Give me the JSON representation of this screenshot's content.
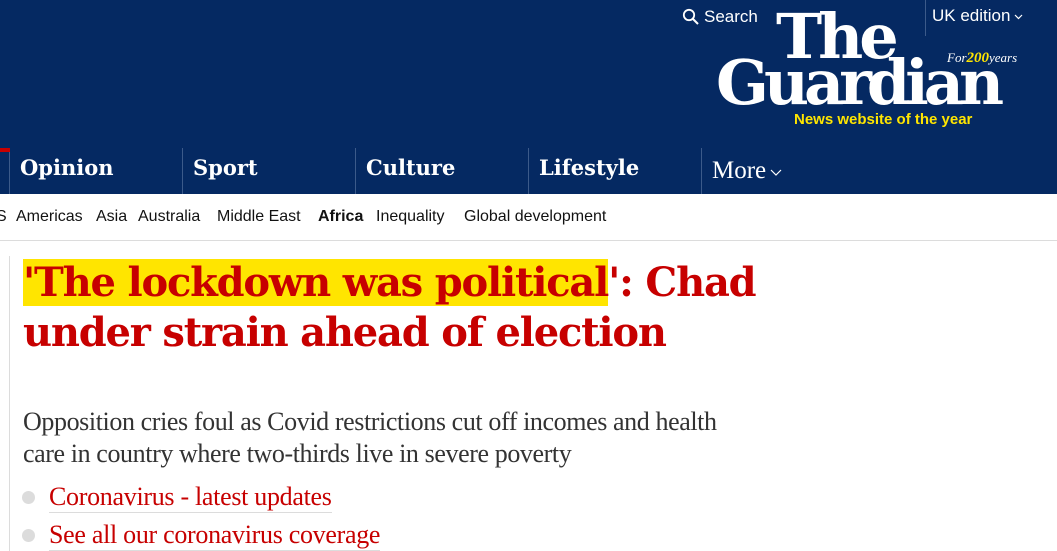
{
  "header": {
    "search_label": "Search",
    "edition_label": "UK edition",
    "logo": {
      "line1": "The",
      "line2": "Guardian",
      "anniversary_prefix": "For",
      "anniversary_number": "200",
      "anniversary_suffix": "years",
      "award": "News website of the year"
    }
  },
  "pillars": [
    {
      "label": "Opinion"
    },
    {
      "label": "Sport"
    },
    {
      "label": "Culture"
    },
    {
      "label": "Lifestyle"
    },
    {
      "label": "More"
    }
  ],
  "subnav": [
    {
      "label": "S"
    },
    {
      "label": "Americas"
    },
    {
      "label": "Asia"
    },
    {
      "label": "Australia"
    },
    {
      "label": "Middle East"
    },
    {
      "label": "Africa",
      "active": true
    },
    {
      "label": "Inequality"
    },
    {
      "label": "Global development"
    }
  ],
  "article": {
    "headline_quote_open": "'",
    "headline_highlight": "The lockdown was political",
    "headline_rest": "': Chad under strain ahead of election",
    "standfirst": "Opposition cries foul as Covid restrictions cut off incomes and health care in country where two-thirds live in severe poverty",
    "links": [
      {
        "label": "Coronavirus - latest updates"
      },
      {
        "label": "See all our coronavirus coverage"
      }
    ]
  },
  "colors": {
    "brand_blue": "#052962",
    "news_red": "#c70000",
    "highlight_yellow": "#ffe500"
  },
  "icons": {
    "search": "search-icon",
    "chevron": "chevron-down-icon",
    "bullet": "bullet-icon"
  }
}
